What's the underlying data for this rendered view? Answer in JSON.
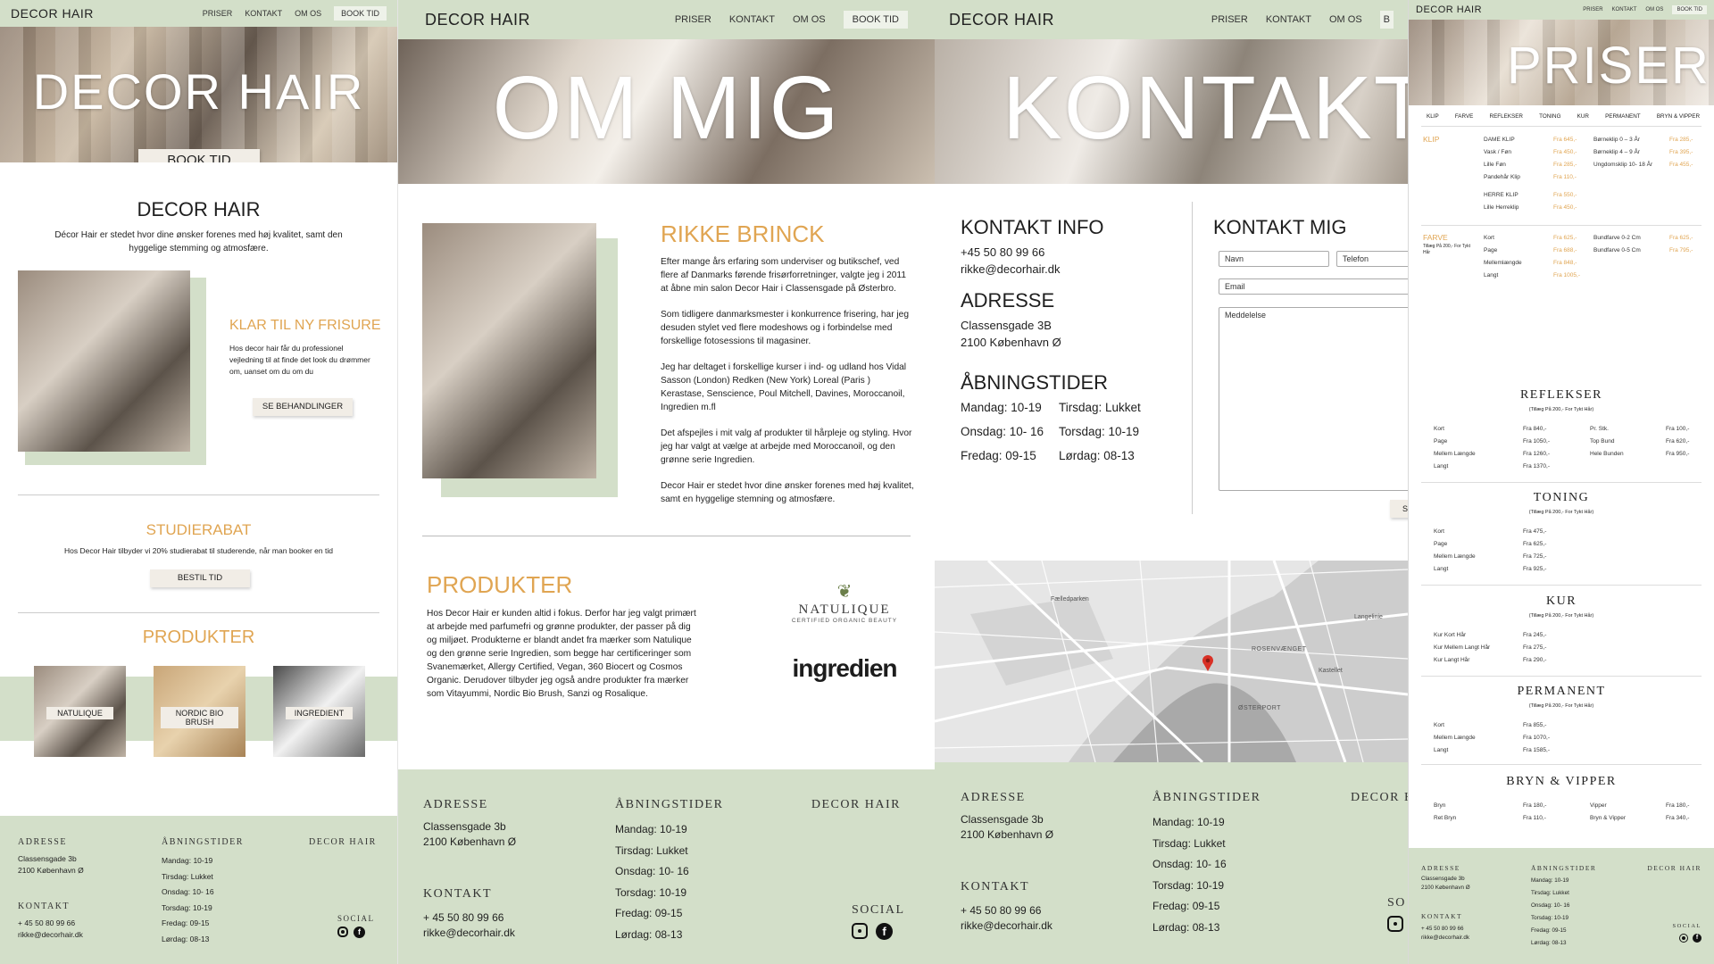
{
  "panel1": {
    "nav": {
      "logo": "DECOR HAIR",
      "links": [
        "PRISER",
        "KONTAKT",
        "OM OS"
      ],
      "cta": "BOOK TID"
    },
    "hero": {
      "title": "DECOR HAIR",
      "button": "BOOK TID"
    },
    "intro": {
      "title": "DECOR HAIR",
      "text": "Décor Hair er stedet hvor dine ønsker forenes med høj kvalitet, samt den hyggelige stemming og atmosfære."
    },
    "frisure": {
      "title": "KLAR TIL NY FRISURE",
      "text": "Hos decor hair får du professionel vejledning til at finde det look du drømmer om, uanset om du om du",
      "button": "SE BEHANDLINGER"
    },
    "studie": {
      "title": "STUDIERABAT",
      "text": "Hos Decor Hair tilbyder vi 20% studierabat til studerende, når man booker en tid",
      "button": "BESTIL TID"
    },
    "produkter": {
      "title": "PRODUKTER",
      "items": [
        "NATULIQUE",
        "NORDIC BIO BRUSH",
        "INGREDIENT"
      ]
    },
    "footer": {
      "adresse_h": "ADRESSE",
      "adresse": [
        "Classensgade 3b",
        "2100 København Ø"
      ],
      "kontakt_h": "KONTAKT",
      "kontakt": [
        "+ 45 50 80 99 66",
        "rikke@decorhair.dk"
      ],
      "tider_h": "ÅBNINGSTIDER",
      "tider": [
        "Mandag: 10-19",
        "Tirsdag: Lukket",
        "Onsdag: 10- 16",
        "Torsdag: 10-19",
        "Fredag: 09-15",
        "Lørdag: 08-13"
      ],
      "brand": "DECOR HAIR",
      "social": "SOCIAL"
    }
  },
  "panel2": {
    "nav": {
      "logo": "DECOR HAIR",
      "links": [
        "PRISER",
        "KONTAKT",
        "OM OS"
      ],
      "cta": "BOOK TID"
    },
    "hero": {
      "title": "OM MIG"
    },
    "about": {
      "name": "RIKKE BRINCK",
      "p1": "Efter mange års erfaring som underviser og butikschef, ved flere af Danmarks førende frisørforretninger, valgte jeg i 2011 at åbne min salon Decor Hair i Classensgade på Østerbro.",
      "p2": "Som tidligere danmarksmester i konkurrence frisering, har jeg desuden stylet ved flere modeshows og i forbindelse med forskellige fotosessions til magasiner.",
      "p3": "Jeg har deltaget i forskellige kurser i ind- og udland hos Vidal Sasson (London) Redken (New York) Loreal (Paris ) Kerastase, Senscience, Poul Mitchell, Davines, Moroccanoil, Ingredien  m.fl",
      "p4": "Det afspejles i mit valg af produkter til hårpleje og styling. Hvor jeg har valgt at vælge at  arbejde med Moroccanoil, og den grønne serie Ingredien.",
      "p5": "Decor Hair er stedet hvor dine ønsker forenes med høj kvalitet, samt en hyggelige stemning og atmosfære."
    },
    "produkter": {
      "title": "PRODUKTER",
      "text": "Hos Decor Hair er kunden altid i fokus. Derfor har jeg valgt primært at arbejde med parfumefri og grønne produkter, der passer på dig og miljøet. Produkterne er blandt andet fra mærker som Natulique og den grønne serie Ingredien, som begge har certificeringer som Svanemærket, Allergy Certified, Vegan, 360 Biocert og Cosmos Organic. Derudover tilbyder jeg også andre produkter fra mærker som Vitayummi, Nordic Bio Brush, Sanzi og Rosalique.",
      "logo1": "NATULIQUE",
      "logo1_sub": "CERTIFIED ORGANIC BEAUTY",
      "logo2": "ingredien"
    },
    "footer": {
      "adresse_h": "ADRESSE",
      "adresse": [
        "Classensgade 3b",
        "2100 København Ø"
      ],
      "kontakt_h": "KONTAKT",
      "kontakt": [
        "+ 45 50 80 99 66",
        "rikke@decorhair.dk"
      ],
      "tider_h": "ÅBNINGSTIDER",
      "tider": [
        "Mandag: 10-19",
        "Tirsdag: Lukket",
        "Onsdag: 10- 16",
        "Torsdag: 10-19",
        "Fredag: 09-15",
        "Lørdag: 08-13"
      ],
      "brand": "DECOR HAIR",
      "social": "SOCIAL"
    }
  },
  "panel3": {
    "nav": {
      "logo": "DECOR HAIR",
      "links": [
        "PRISER",
        "KONTAKT",
        "OM OS"
      ],
      "cta": "B"
    },
    "hero": {
      "title": "KONTAKT"
    },
    "info": {
      "title": "KONTAKT INFO",
      "phone": "+45 50 80 99 66",
      "email": "rikke@decorhair.dk",
      "adresse_title": "ADRESSE",
      "adresse1": "Classensgade 3B",
      "adresse2": "2100 København Ø",
      "tider_title": "ÅBNINGSTIDER",
      "tider": [
        "Mandag: 10-19",
        "Tirsdag: Lukket",
        "Onsdag: 10- 16",
        "Torsdag: 10-19",
        "Fredag: 09-15",
        "Lørdag: 08-13"
      ]
    },
    "form": {
      "title": "KONTAKT MIG",
      "navn": "Navn",
      "telefon": "Telefon",
      "email": "Email",
      "besked": "Meddelelse",
      "send": "SE"
    },
    "map": {
      "labels": [
        "ROSENVÆNGET",
        "ØSTERPORT",
        "Fælledparken",
        "Kastellet",
        "Langelinie"
      ]
    },
    "footer": {
      "adresse_h": "ADRESSE",
      "adresse": [
        "Classensgade 3b",
        "2100 København Ø"
      ],
      "kontakt_h": "KONTAKT",
      "kontakt": [
        "+ 45 50 80 99 66",
        "rikke@decorhair.dk"
      ],
      "tider_h": "ÅBNINGSTIDER",
      "tider": [
        "Mandag: 10-19",
        "Tirsdag: Lukket",
        "Onsdag: 10- 16",
        "Torsdag: 10-19",
        "Fredag: 09-15",
        "Lørdag: 08-13"
      ],
      "brand": "DECOR H",
      "social": "SO"
    }
  },
  "panel4": {
    "nav": {
      "logo": "DECOR HAIR",
      "links": [
        "PRISER",
        "KONTAKT",
        "OM OS"
      ],
      "cta": "BOOK TID"
    },
    "hero": {
      "title": "PRISER"
    },
    "tabs": [
      "KLIP",
      "FARVE",
      "REFLEKSER",
      "TONING",
      "KUR",
      "PERMANENT",
      "BRYN & VIPPER"
    ],
    "klip": {
      "label": "KLIP",
      "rows": [
        [
          "DAME KLIP",
          "Fra 645,-",
          "Børneklip 0 – 3 År",
          "Fra 285,-"
        ],
        [
          "Vask / Føn",
          "Fra 450,-",
          "Børneklip 4 – 9 År",
          "Fra 395,-"
        ],
        [
          "Lille Føn",
          "Fra 285,-",
          "Ungdomsklip 10- 18 År",
          "Fra 455,-"
        ],
        [
          "Pandehår Klip",
          "Fra 110,-",
          "",
          ""
        ],
        [
          "HERRE KLIP",
          "Fra 550,-",
          "",
          ""
        ],
        [
          "Lille Herreklip",
          "Fra 450,-",
          "",
          ""
        ]
      ]
    },
    "farve": {
      "label": "FARVE",
      "sub": "Tillæg På 200,- For Tykt Hår",
      "rows": [
        [
          "Kort",
          "Fra 625,-",
          "Bundfarve 0-2 Cm",
          "Fra 625,-"
        ],
        [
          "Page",
          "Fra 688,-",
          "Bundfarve 0-5 Cm",
          "Fra 795,-"
        ],
        [
          "Mellemlængde",
          "Fra 848,-",
          "",
          ""
        ],
        [
          "Langt",
          "Fra 1005,-",
          "",
          ""
        ]
      ]
    },
    "refleks": {
      "title": "REFLEKSER",
      "sub": "(Tillæg På 200,- For Tykt Hår)",
      "rows": [
        [
          "Kort",
          "Fra 840,-",
          "Pr. Stk.",
          "Fra 100,-"
        ],
        [
          "Page",
          "Fra 1050,-",
          "Top Bund",
          "Fra 620,-"
        ],
        [
          "Mellem Længde",
          "Fra 1260,-",
          "Hele Bunden",
          "Fra 950,-"
        ],
        [
          "Langt",
          "Fra 1370,-",
          "",
          ""
        ]
      ]
    },
    "toning": {
      "title": "TONING",
      "sub": "(Tillæg På 200,- For Tykt Hår)",
      "rows": [
        [
          "Kort",
          "Fra 475,-"
        ],
        [
          "Page",
          "Fra 625,-"
        ],
        [
          "Mellem Længde",
          "Fra 725,-"
        ],
        [
          "Langt",
          "Fra 925,-"
        ]
      ]
    },
    "kur": {
      "title": "KUR",
      "sub": "(Tillæg På 200,- For Tykt Hår)",
      "rows": [
        [
          "Kur Kort Hår",
          "Fra 245,-"
        ],
        [
          "Kur Mellem Langt Hår",
          "Fra 275,-"
        ],
        [
          "Kur Langt Hår",
          "Fra 290,-"
        ]
      ]
    },
    "perm": {
      "title": "PERMANENT",
      "sub": "(Tillæg På 200,- For Tykt Hår)",
      "rows": [
        [
          "Kort",
          "Fra 855,-"
        ],
        [
          "Mellem Længde",
          "Fra 1070,-"
        ],
        [
          "Langt",
          "Fra 1585,-"
        ]
      ]
    },
    "bryn": {
      "title": "BRYN & VIPPER",
      "rows": [
        [
          "Bryn",
          "Fra 180,-",
          "Vipper",
          "Fra 180,-"
        ],
        [
          "Ret Bryn",
          "Fra 110,-",
          "Bryn & Vipper",
          "Fra 340,-"
        ]
      ]
    },
    "footer": {
      "adresse_h": "ADRESSE",
      "adresse": [
        "Classensgade 3b",
        "2100 København Ø"
      ],
      "kontakt_h": "KONTAKT",
      "kontakt": [
        "+ 45 50 80 99 66",
        "rikke@decorhair.dk"
      ],
      "tider_h": "ÅBNINGSTIDER",
      "tider": [
        "Mandag: 10-19",
        "Tirsdag: Lukket",
        "Onsdag: 10- 16",
        "Torsdag: 10-19",
        "Fredag: 09-15",
        "Lørdag: 08-13"
      ],
      "brand": "DECOR HAIR",
      "social": "SOCIAL"
    }
  }
}
